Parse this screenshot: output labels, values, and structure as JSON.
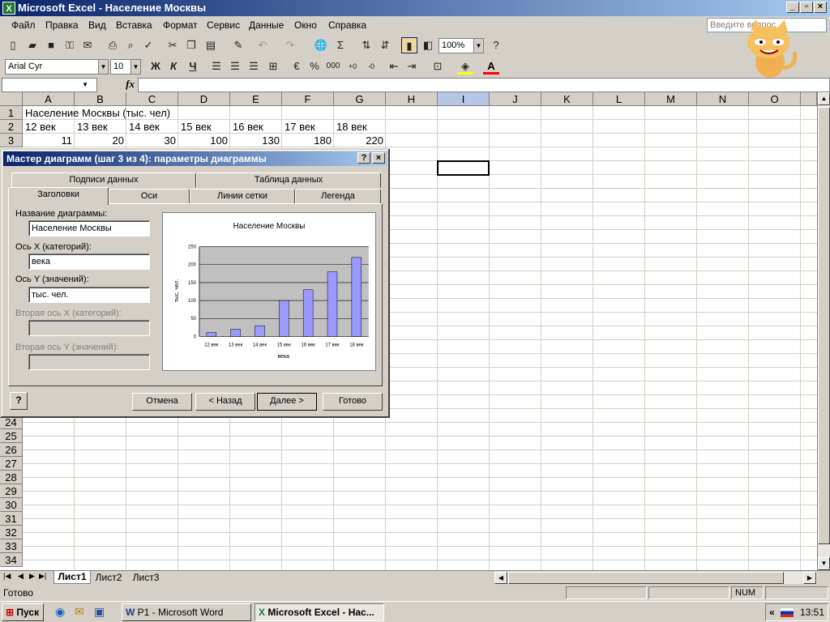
{
  "window": {
    "title": "Microsoft Excel - Население Москвы"
  },
  "menu": [
    "Файл",
    "Правка",
    "Вид",
    "Вставка",
    "Формат",
    "Сервис",
    "Данные",
    "Окно",
    "Справка"
  ],
  "ask_placeholder": "Введите вопрос",
  "toolbar": {
    "zoom": "100%",
    "font": "Arial Cyr",
    "size": "10",
    "bold": "Ж",
    "italic": "К",
    "underline": "Ч",
    "percent": "%",
    "thousands": "000"
  },
  "columns": [
    "A",
    "B",
    "C",
    "D",
    "E",
    "F",
    "G",
    "H",
    "I",
    "J",
    "K",
    "L",
    "M",
    "N",
    "O"
  ],
  "rows_top": [
    "1",
    "2",
    "3"
  ],
  "rows_bottom": [
    "24",
    "25",
    "26",
    "27",
    "28",
    "29",
    "30",
    "31",
    "32",
    "33",
    "34"
  ],
  "cells": {
    "a1": "Население Москвы (тыс. чел)",
    "row2": [
      "12 век",
      "13 век",
      "14 век",
      "15 век",
      "16 век",
      "17 век",
      "18 век"
    ],
    "row3": [
      "11",
      "20",
      "30",
      "100",
      "130",
      "180",
      "220"
    ]
  },
  "sheets": [
    "Лист1",
    "Лист2",
    "Лист3"
  ],
  "status": {
    "ready": "Готово",
    "num": "NUM"
  },
  "taskbar": {
    "start": "Пуск",
    "task1": "P1 - Microsoft Word",
    "task2": "Microsoft Excel - Нас...",
    "clock": "13:51"
  },
  "dialog": {
    "title": "Мастер диаграмм (шаг 3 из 4): параметры диаграммы",
    "tabs_back": [
      "Подписи данных",
      "Таблица данных"
    ],
    "tabs_front": [
      "Заголовки",
      "Оси",
      "Линии сетки",
      "Легенда"
    ],
    "labels": {
      "chart_title": "Название диаграммы:",
      "x_axis": "Ось X (категорий):",
      "y_axis": "Ось Y (значений):",
      "x2_axis": "Вторая ось X (категорий):",
      "y2_axis": "Вторая ось Y (значений):"
    },
    "values": {
      "chart_title": "Население Москвы",
      "x_axis": "века",
      "y_axis": "тыс. чел."
    },
    "buttons": {
      "cancel": "Отмена",
      "back": "< Назад",
      "next": "Далее >",
      "finish": "Готово"
    }
  },
  "chart_data": {
    "type": "bar",
    "title": "Население Москвы",
    "xlabel": "века",
    "ylabel": "тыс. чел.",
    "categories": [
      "12 век",
      "13 век",
      "14 век",
      "15 век",
      "16 век",
      "17 век",
      "18 век"
    ],
    "values": [
      11,
      20,
      30,
      100,
      130,
      180,
      220
    ],
    "yticks": [
      "0",
      "50",
      "100",
      "150",
      "200",
      "250"
    ],
    "ylim": [
      0,
      250
    ],
    "grid": true,
    "bar_color": "#9999ff",
    "plot_bg": "#c0c0c0"
  }
}
